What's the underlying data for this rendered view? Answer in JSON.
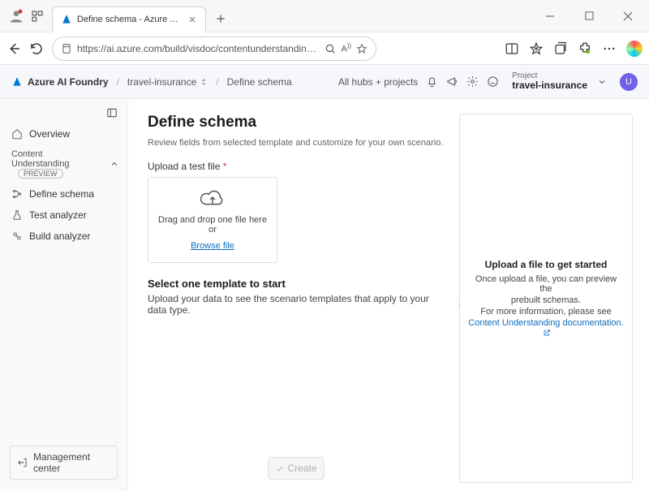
{
  "browser": {
    "tab_title": "Define schema - Azure AI Foundr",
    "url": "https://ai.azure.com/build/visdoc/contentunderstanding/schema?tid=..."
  },
  "appbar": {
    "brand": "Azure AI Foundry",
    "crumb_project": "travel-insurance",
    "crumb_page": "Define schema",
    "hubs_label": "All hubs + projects",
    "project_label": "Project",
    "project_value": "travel-insurance",
    "user_initial": "U"
  },
  "sidebar": {
    "overview": "Overview",
    "group_label": "Content Understanding",
    "preview_badge": "PREVIEW",
    "define_schema": "Define schema",
    "test_analyzer": "Test analyzer",
    "build_analyzer": "Build analyzer",
    "management_center": "Management center"
  },
  "page": {
    "title": "Define schema",
    "description": "Review fields from selected template and customize for your own scenario.",
    "upload_label": "Upload a test file",
    "drag_text": "Drag and drop one file here or",
    "browse_text": "Browse file",
    "template_heading": "Select one template to start",
    "template_help": "Upload your data to see the scenario templates that apply to your data type.",
    "create_label": "Create"
  },
  "preview": {
    "title": "Upload a file to get started",
    "line1": "Once upload a file, you can preview the",
    "line2": "prebuilt schemas.",
    "line3": "For more information, please see",
    "link": "Content Understanding documentation."
  }
}
